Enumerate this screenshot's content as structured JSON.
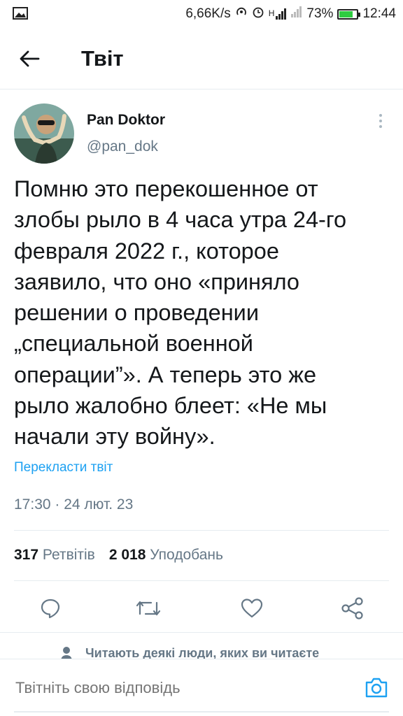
{
  "status_bar": {
    "net_speed": "6,66K/s",
    "signal_label": "H",
    "battery": "73%",
    "battery_level": 0.73,
    "time": "12:44"
  },
  "header": {
    "title": "Твіт",
    "back_icon": "arrow-left-icon"
  },
  "tweet": {
    "author_name": "Pan Doktor",
    "author_handle": "@pan_dok",
    "text": "Помню это перекошенное от\nзлобы рыло в 4 часа утра 24-го\nфевраля 2022 г., которое\nзаявило, что оно «приняло\nрешении о проведении\n„специальной военной\nоперации”». А теперь это же\nрыло жалобно блеет: «Не мы\nначали эту войну».",
    "translate_label": "Перекласти твіт",
    "timestamp": "17:30 · 24 лют. 23",
    "retweets_count": "317",
    "retweets_label": "Ретвітів",
    "likes_count": "2 018",
    "likes_label": "Уподобань"
  },
  "actions": {
    "icons": [
      "reply-icon",
      "retweet-icon",
      "like-icon",
      "share-icon"
    ]
  },
  "followers_note": "Читають деякі люди, яких ви читаєте",
  "reply": {
    "placeholder": "Твітніть свою відповідь"
  },
  "colors": {
    "accent": "#1da1f2",
    "secondary_text": "#657786",
    "primary_text": "#14171a",
    "divider": "#e6ecf0"
  }
}
